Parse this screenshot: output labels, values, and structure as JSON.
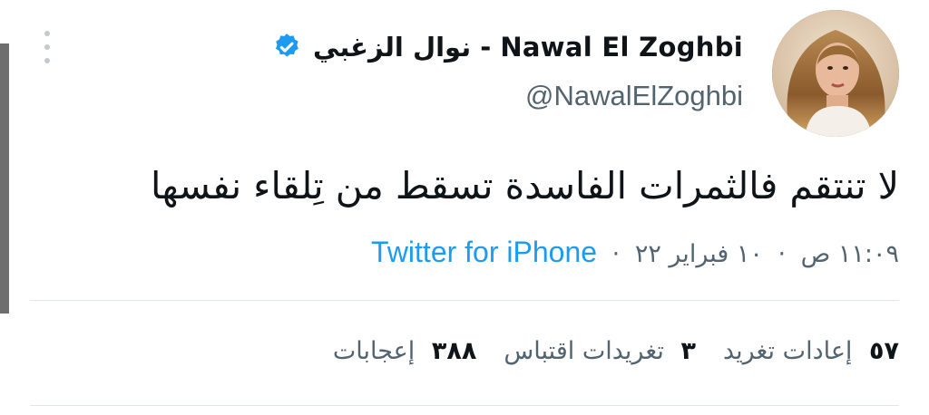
{
  "tweet": {
    "author": {
      "display_name": "نوال الزغبي - Nawal El Zoghbi",
      "handle": "@NawalElZoghbi",
      "verified": true,
      "verified_color": "#1d9bf0"
    },
    "text": "لا تنتقم فالثمرات الفاسدة تسقط من تِلقاء نفسها",
    "time": "١١:٠٩ ص",
    "date": "١٠ فبراير ٢٢",
    "separator": "·",
    "source": "Twitter for iPhone",
    "source_color": "#1d9bf0"
  },
  "stats": [
    {
      "value": "٥٧",
      "label": "إعادات تغريد"
    },
    {
      "value": "٣",
      "label": "تغريدات اقتباس"
    },
    {
      "value": "٣٨٨",
      "label": "إعجابات"
    }
  ],
  "icons": {
    "more": "more-vertical-icon",
    "verified": "verified-badge-icon"
  }
}
